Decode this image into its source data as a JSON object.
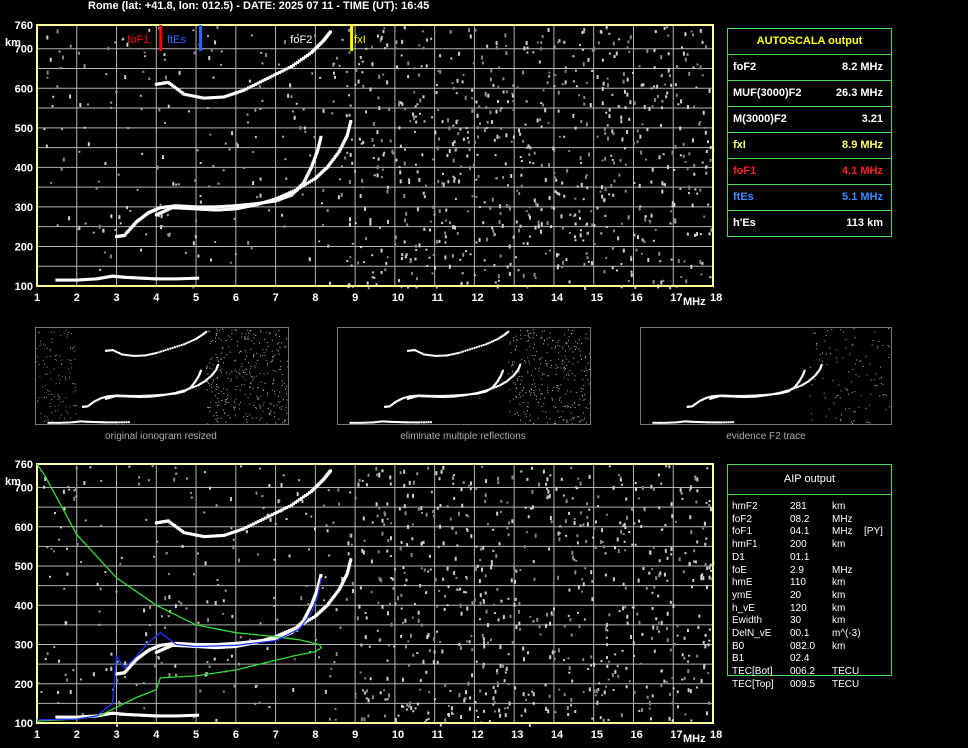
{
  "header": {
    "title": "Rome (lat: +41.8, lon: 012.5) - DATE: 2025 07 11 - TIME (UT): 16:45"
  },
  "colors": {
    "grid": "#b3b3b3",
    "frame": "#ffff99",
    "foF1": "#ff0000",
    "ftEs": "#1e6bff",
    "fxI": "#ffff00",
    "profile": "#33dd33",
    "model": "#2233ff"
  },
  "chart_data": [
    {
      "type": "scatter",
      "name_id": "autoscala-ionogram",
      "xlabel": "MHz",
      "ylabel": "km",
      "xlim": [
        1,
        18
      ],
      "ylim": [
        100,
        760
      ],
      "x_ticks": [
        "1",
        "2",
        "3",
        "4",
        "5",
        "6",
        "7",
        "8",
        "9",
        "10",
        "11",
        "12",
        "13",
        "14",
        "15",
        "16",
        "17",
        "18"
      ],
      "y_ticks": [
        "100",
        "200",
        "300",
        "400",
        "500",
        "600",
        "700",
        "760"
      ],
      "grid": true,
      "markers": [
        {
          "label": "foF1",
          "freq": 4.1,
          "color": "#ff0000"
        },
        {
          "label": "ftEs",
          "freq": 5.1,
          "color": "#1e6bff"
        },
        {
          "label": "foF2",
          "freq": 8.2,
          "color": "#ffffff"
        },
        {
          "label": "fxI",
          "freq": 8.9,
          "color": "#ffff00"
        }
      ],
      "traces": [
        {
          "id": "o-mode",
          "points": [
            [
              3.0,
              225
            ],
            [
              3.2,
              228
            ],
            [
              3.5,
              262
            ],
            [
              3.8,
              285
            ],
            [
              4.1,
              298
            ],
            [
              4.5,
              303
            ],
            [
              5,
              300
            ],
            [
              5.5,
              300
            ],
            [
              6,
              303
            ],
            [
              6.5,
              308
            ],
            [
              7,
              315
            ],
            [
              7.4,
              330
            ],
            [
              7.7,
              360
            ],
            [
              7.9,
              400
            ],
            [
              8.05,
              440
            ],
            [
              8.15,
              480
            ]
          ]
        },
        {
          "id": "x-mode",
          "points": [
            [
              4.0,
              280
            ],
            [
              4.4,
              298
            ],
            [
              5,
              295
            ],
            [
              5.5,
              292
            ],
            [
              6,
              295
            ],
            [
              6.5,
              305
            ],
            [
              7,
              320
            ],
            [
              7.5,
              342
            ],
            [
              8,
              372
            ],
            [
              8.3,
              400
            ],
            [
              8.6,
              440
            ],
            [
              8.8,
              480
            ],
            [
              8.9,
              520
            ]
          ]
        },
        {
          "id": "second-hop",
          "points": [
            [
              4.0,
              610
            ],
            [
              4.3,
              615
            ],
            [
              4.7,
              585
            ],
            [
              5.2,
              575
            ],
            [
              5.7,
              578
            ],
            [
              6.2,
              595
            ],
            [
              6.8,
              625
            ],
            [
              7.4,
              655
            ],
            [
              7.9,
              690
            ],
            [
              8.2,
              720
            ],
            [
              8.4,
              745
            ]
          ]
        },
        {
          "id": "es-trace",
          "points": [
            [
              1.5,
              115
            ],
            [
              2,
              115
            ],
            [
              2.5,
              118
            ],
            [
              2.9,
              125
            ],
            [
              3.2,
              122
            ],
            [
              3.6,
              120
            ],
            [
              4,
              118
            ],
            [
              4.5,
              118
            ],
            [
              5.1,
              120
            ]
          ]
        }
      ]
    },
    {
      "type": "line",
      "name_id": "aip-ionogram",
      "xlabel": "MHz",
      "ylabel": "km",
      "xlim": [
        1,
        18
      ],
      "ylim": [
        100,
        760
      ],
      "x_ticks": [
        "1",
        "2",
        "3",
        "4",
        "5",
        "6",
        "7",
        "8",
        "9",
        "10",
        "11",
        "12",
        "13",
        "14",
        "15",
        "16",
        "17",
        "18"
      ],
      "y_ticks": [
        "100",
        "200",
        "300",
        "400",
        "500",
        "600",
        "700",
        "760"
      ],
      "grid": true,
      "series": [
        {
          "id": "real-height-profile",
          "points": [
            [
              1,
              105
            ],
            [
              2,
              110
            ],
            [
              2.6,
              120
            ],
            [
              3,
              140
            ],
            [
              3.5,
              165
            ],
            [
              4,
              185
            ],
            [
              4.1,
              215
            ],
            [
              5,
              220
            ],
            [
              6,
              235
            ],
            [
              6.8,
              255
            ],
            [
              7.5,
              272
            ],
            [
              8,
              282
            ],
            [
              8.15,
              292
            ],
            [
              8.1,
              300
            ],
            [
              7.6,
              312
            ],
            [
              7,
              320
            ],
            [
              6,
              330
            ],
            [
              5,
              350
            ],
            [
              4,
              400
            ],
            [
              3,
              470
            ],
            [
              2,
              580
            ],
            [
              1.2,
              730
            ],
            [
              1,
              760
            ]
          ]
        },
        {
          "id": "virtual-model",
          "points": [
            [
              1,
              108
            ],
            [
              2,
              110
            ],
            [
              2.5,
              118
            ],
            [
              2.9,
              150
            ],
            [
              3.0,
              270
            ],
            [
              3.2,
              240
            ],
            [
              3.5,
              270
            ],
            [
              3.8,
              305
            ],
            [
              4.1,
              330
            ],
            [
              4.5,
              300
            ],
            [
              5,
              295
            ],
            [
              6,
              298
            ],
            [
              7,
              310
            ],
            [
              7.6,
              340
            ],
            [
              7.9,
              380
            ],
            [
              8.05,
              420
            ],
            [
              8.15,
              470
            ]
          ]
        }
      ],
      "traces": [
        {
          "id": "o-mode",
          "points": [
            [
              3.0,
              225
            ],
            [
              3.2,
              228
            ],
            [
              3.5,
              262
            ],
            [
              3.8,
              285
            ],
            [
              4.1,
              298
            ],
            [
              4.5,
              303
            ],
            [
              5,
              300
            ],
            [
              5.5,
              300
            ],
            [
              6,
              303
            ],
            [
              6.5,
              308
            ],
            [
              7,
              315
            ],
            [
              7.4,
              330
            ],
            [
              7.7,
              360
            ],
            [
              7.9,
              400
            ],
            [
              8.05,
              440
            ],
            [
              8.15,
              480
            ]
          ]
        },
        {
          "id": "x-mode",
          "points": [
            [
              4.0,
              280
            ],
            [
              4.4,
              298
            ],
            [
              5,
              295
            ],
            [
              5.5,
              292
            ],
            [
              6,
              295
            ],
            [
              6.5,
              305
            ],
            [
              7,
              320
            ],
            [
              7.5,
              342
            ],
            [
              8,
              372
            ],
            [
              8.3,
              400
            ],
            [
              8.6,
              440
            ],
            [
              8.8,
              480
            ],
            [
              8.9,
              520
            ]
          ]
        },
        {
          "id": "second-hop",
          "points": [
            [
              4.0,
              610
            ],
            [
              4.3,
              615
            ],
            [
              4.7,
              585
            ],
            [
              5.2,
              575
            ],
            [
              5.7,
              578
            ],
            [
              6.2,
              595
            ],
            [
              6.8,
              625
            ],
            [
              7.4,
              655
            ],
            [
              7.9,
              690
            ],
            [
              8.2,
              720
            ],
            [
              8.4,
              745
            ]
          ]
        },
        {
          "id": "es-trace",
          "points": [
            [
              1.5,
              115
            ],
            [
              2,
              115
            ],
            [
              2.5,
              118
            ],
            [
              2.9,
              125
            ],
            [
              3.2,
              122
            ],
            [
              3.6,
              120
            ],
            [
              4,
              118
            ],
            [
              4.5,
              118
            ],
            [
              5.1,
              120
            ]
          ]
        }
      ]
    }
  ],
  "thumbnails": [
    {
      "caption": "original ionogram resized"
    },
    {
      "caption": "eliminate multiple reflections"
    },
    {
      "caption": "evidence F2 trace"
    }
  ],
  "autoscala": {
    "title": "AUTOSCALA output",
    "rows": [
      {
        "label": "foF2",
        "value": "8.2 MHz",
        "color": "#ffffff"
      },
      {
        "label": "MUF(3000)F2",
        "value": "26.3 MHz",
        "color": "#ffffff"
      },
      {
        "label": "M(3000)F2",
        "value": "3.21",
        "color": "#ffffff"
      },
      {
        "label": "fxI",
        "value": "8.9 MHz",
        "color": "#ffff66"
      },
      {
        "label": "foF1",
        "value": "4.1 MHz",
        "color": "#ff2020"
      },
      {
        "label": "ftEs",
        "value": "5.1 MHz",
        "color": "#3a8cff"
      },
      {
        "label": "h'Es",
        "value": "113    km",
        "color": "#ffffff"
      }
    ]
  },
  "aip": {
    "title": "AIP output",
    "rows": [
      {
        "label": "hmF2",
        "value": "281",
        "unit": "km",
        "extra": ""
      },
      {
        "label": "foF2",
        "value": "08.2",
        "unit": "MHz",
        "extra": ""
      },
      {
        "label": "foF1",
        "value": "04.1",
        "unit": "MHz",
        "extra": "[PY]"
      },
      {
        "label": "hmF1",
        "value": "200",
        "unit": "km",
        "extra": ""
      },
      {
        "label": "D1",
        "value": "01.1",
        "unit": "",
        "extra": ""
      },
      {
        "label": "foE",
        "value": "2.9",
        "unit": "MHz",
        "extra": ""
      },
      {
        "label": "hmE",
        "value": "110",
        "unit": "km",
        "extra": ""
      },
      {
        "label": "ymE",
        "value": "20",
        "unit": "km",
        "extra": ""
      },
      {
        "label": "h_vE",
        "value": "120",
        "unit": "km",
        "extra": ""
      },
      {
        "label": "Ewidth",
        "value": "30",
        "unit": "km",
        "extra": ""
      },
      {
        "label": "DelN_vE",
        "value": "00.1",
        "unit": "m^(-3)",
        "extra": ""
      },
      {
        "label": "B0",
        "value": "082.0",
        "unit": "km",
        "extra": ""
      },
      {
        "label": "B1",
        "value": "02.4",
        "unit": "",
        "extra": ""
      },
      {
        "label": "TEC[Bot]",
        "value": "006.2",
        "unit": "TECU",
        "extra": ""
      },
      {
        "label": "TEC[Top]",
        "value": "009.5",
        "unit": "TECU",
        "extra": ""
      }
    ]
  }
}
